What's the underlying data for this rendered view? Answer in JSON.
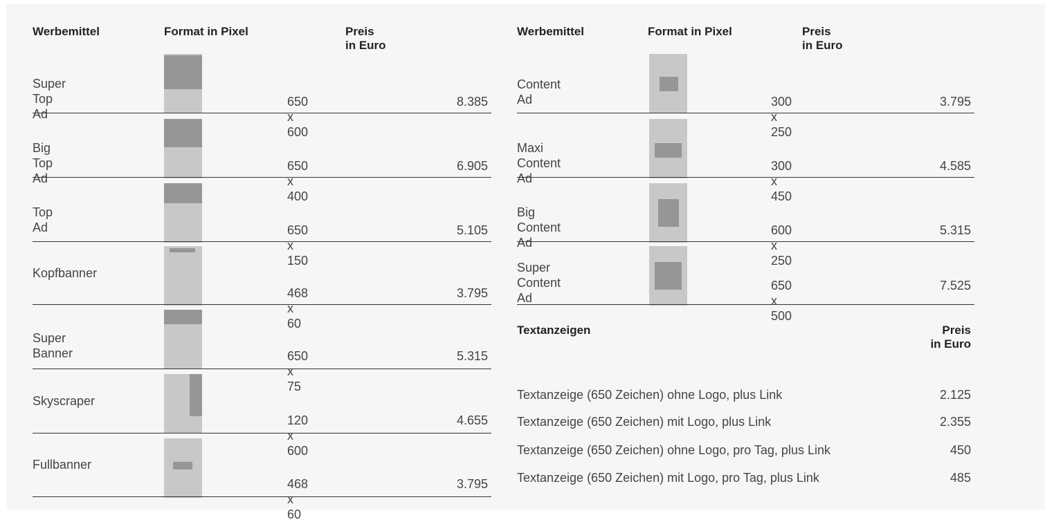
{
  "left_table": {
    "headers": {
      "name": "Werbemittel",
      "format": "Format in Pixel",
      "price_line1": "Preis",
      "price_line2": "in Euro"
    },
    "rows": [
      {
        "label_line1": "Super",
        "label_line2": "Top Ad",
        "format": "650 x 600",
        "price": "8.385"
      },
      {
        "label_line1": "Big",
        "label_line2": "Top Ad",
        "format": "650 x 400",
        "price": "6.905"
      },
      {
        "label_line1": "Top",
        "label_line2": "Ad",
        "format": "650 x 150",
        "price": "5.105"
      },
      {
        "label_line1": "Kopfbanner",
        "label_line2": "",
        "format": "468 x 60",
        "price": "3.795"
      },
      {
        "label_line1": "Super",
        "label_line2": "Banner",
        "format": "650 x 75",
        "price": "5.315"
      },
      {
        "label_line1": "Skyscraper",
        "label_line2": "",
        "format": "120 x 600",
        "price": "4.655"
      },
      {
        "label_line1": "Fullbanner",
        "label_line2": "",
        "format": "468 x 60",
        "price": "3.795"
      }
    ]
  },
  "right_table": {
    "headers": {
      "name": "Werbemittel",
      "format": "Format in Pixel",
      "price_line1": "Preis",
      "price_line2": "in Euro"
    },
    "rows": [
      {
        "label_line1": "Content Ad",
        "label_line2": "",
        "format": "300 x 250",
        "price": "3.795"
      },
      {
        "label_line1": "Maxi",
        "label_line2": "Content Ad",
        "format": "300 x 450",
        "price": "4.585"
      },
      {
        "label_line1": "Big",
        "label_line2": "Content Ad",
        "format": "600 x 250",
        "price": "5.315"
      },
      {
        "label_line1": "Super",
        "label_line2": "Content Ad",
        "format": "650 x 500",
        "price": "7.525"
      }
    ]
  },
  "text_ads": {
    "title": "Textanzeigen",
    "price_line1": "Preis",
    "price_line2": "in Euro",
    "items": [
      {
        "label": "Textanzeige (650 Zeichen) ohne Logo, plus Link",
        "price": "2.125"
      },
      {
        "label": "Textanzeige (650 Zeichen) mit Logo, plus Link",
        "price": "2.355"
      },
      {
        "label": "Textanzeige (650 Zeichen) ohne Logo, pro Tag, plus Link",
        "price": "450"
      },
      {
        "label": "Textanzeige (650 Zeichen) mit Logo, pro Tag, plus Link",
        "price": "485"
      }
    ]
  }
}
